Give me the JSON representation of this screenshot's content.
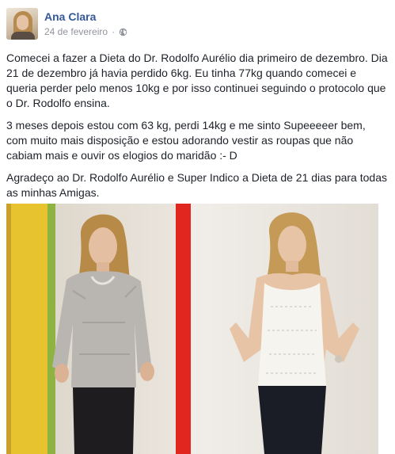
{
  "post": {
    "author": "Ana Clara",
    "date": "24 de fevereiro",
    "separator": "·",
    "privacy_icon": "globe-icon",
    "paragraphs": [
      "Comecei a fazer a Dieta do Dr. Rodolfo Aurélio dia primeiro de dezembro. Dia 21 de dezembro já havia perdido 6kg. Eu tinha 77kg quando comecei e queria perder pelo menos 10kg e por isso continuei seguindo o protocolo que o Dr. Rodolfo ensina.",
      "3 meses depois estou com 63 kg, perdi 14kg e me sinto Supeeeeer bem, com muito mais disposição e estou adorando vestir as roupas que não cabiam mais e ouvir os elogios do maridão :- D",
      "Agradeço ao Dr. Rodolfo Aurélio e Super Indico a Dieta de 21 dias para todas as minhas Amigas."
    ]
  },
  "colors": {
    "author_link": "#365899",
    "meta_text": "#90949c",
    "body_text": "#1d2129",
    "photo_stripe_yellow": "#e8c330",
    "photo_stripe_green": "#8fb342",
    "photo_stripe_red": "#e0261f"
  }
}
